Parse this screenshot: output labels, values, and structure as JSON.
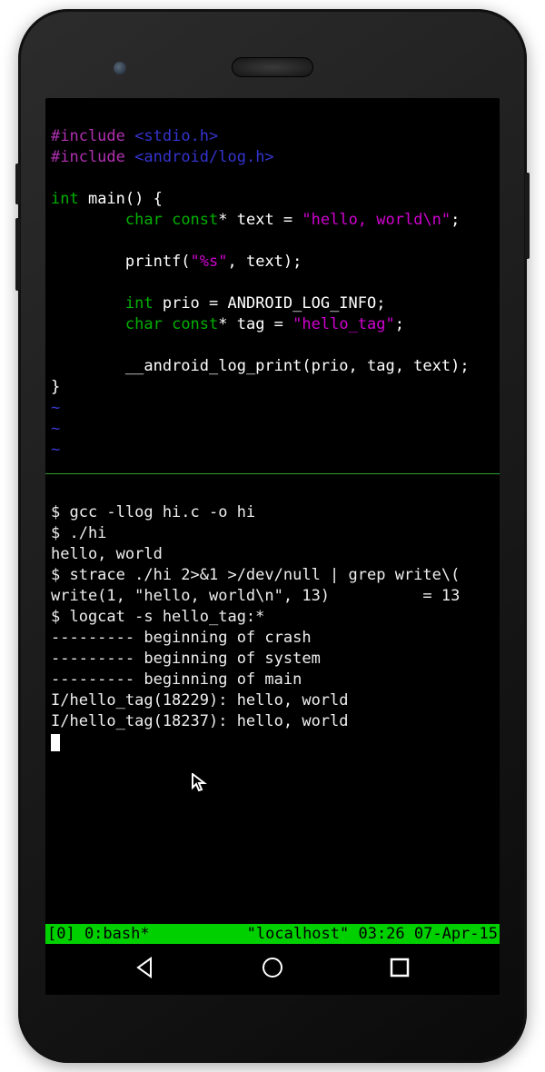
{
  "code": {
    "include1_directive": "#include",
    "include1_target": "<stdio.h>",
    "include2_directive": "#include",
    "include2_target": "<android/log.h>",
    "main_kw_int": "int",
    "main_sig": " main() {",
    "l4_char": "char",
    "l4_const": " const",
    "l4_rest": "* text = ",
    "l4_str": "\"hello, world\\n\"",
    "l4_semi": ";",
    "l6_printf": "printf(",
    "l6_fmt": "\"%s\"",
    "l6_rest": ", text);",
    "l8_int": "int",
    "l8_rest": " prio = ANDROID_LOG_INFO;",
    "l9_char": "char",
    "l9_const": " const",
    "l9_rest": "* tag = ",
    "l9_str": "\"hello_tag\"",
    "l9_semi": ";",
    "l11": "__android_log_print(prio, tag, text);",
    "close": "}",
    "tilde": "~"
  },
  "terminal": {
    "l1": "$ gcc -llog hi.c -o hi",
    "l2": "$ ./hi",
    "l3": "hello, world",
    "l4": "$ strace ./hi 2>&1 >/dev/null | grep write\\(",
    "l5": "write(1, \"hello, world\\n\", 13)          = 13",
    "l6": "$ logcat -s hello_tag:*",
    "l7": "--------- beginning of crash",
    "l8": "--------- beginning of system",
    "l9": "--------- beginning of main",
    "l10": "I/hello_tag(18229): hello, world",
    "l11": "I/hello_tag(18237): hello, world"
  },
  "tmux": {
    "left": "[0] 0:bash*",
    "right": "\"localhost\" 03:26 07-Apr-15"
  }
}
